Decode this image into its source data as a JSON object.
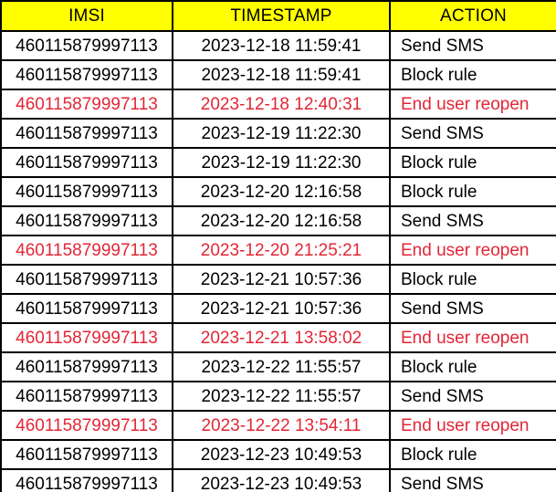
{
  "table": {
    "columns": [
      {
        "key": "imsi",
        "label": "IMSI"
      },
      {
        "key": "timestamp",
        "label": "TIMESTAMP"
      },
      {
        "key": "action",
        "label": "ACTION"
      }
    ],
    "header_background": "#FFFF00",
    "highlight_color": "#E32636",
    "text_color": "#000000",
    "border_color": "#000000",
    "rows": [
      {
        "imsi": "460115879997113",
        "timestamp": "2023-12-18 11:59:41",
        "action": "Send SMS",
        "highlighted": false
      },
      {
        "imsi": "460115879997113",
        "timestamp": "2023-12-18 11:59:41",
        "action": "Block rule",
        "highlighted": false
      },
      {
        "imsi": "460115879997113",
        "timestamp": "2023-12-18 12:40:31",
        "action": "End user reopen",
        "highlighted": true
      },
      {
        "imsi": "460115879997113",
        "timestamp": "2023-12-19 11:22:30",
        "action": "Send SMS",
        "highlighted": false
      },
      {
        "imsi": "460115879997113",
        "timestamp": "2023-12-19 11:22:30",
        "action": "Block rule",
        "highlighted": false
      },
      {
        "imsi": "460115879997113",
        "timestamp": "2023-12-20 12:16:58",
        "action": "Block rule",
        "highlighted": false
      },
      {
        "imsi": "460115879997113",
        "timestamp": "2023-12-20 12:16:58",
        "action": "Send SMS",
        "highlighted": false
      },
      {
        "imsi": "460115879997113",
        "timestamp": "2023-12-20 21:25:21",
        "action": "End user reopen",
        "highlighted": true
      },
      {
        "imsi": "460115879997113",
        "timestamp": "2023-12-21 10:57:36",
        "action": "Block rule",
        "highlighted": false
      },
      {
        "imsi": "460115879997113",
        "timestamp": "2023-12-21 10:57:36",
        "action": "Send SMS",
        "highlighted": false
      },
      {
        "imsi": "460115879997113",
        "timestamp": "2023-12-21 13:58:02",
        "action": "End user reopen",
        "highlighted": true
      },
      {
        "imsi": "460115879997113",
        "timestamp": "2023-12-22 11:55:57",
        "action": "Block rule",
        "highlighted": false
      },
      {
        "imsi": "460115879997113",
        "timestamp": "2023-12-22 11:55:57",
        "action": "Send SMS",
        "highlighted": false
      },
      {
        "imsi": "460115879997113",
        "timestamp": "2023-12-22 13:54:11",
        "action": "End user reopen",
        "highlighted": true
      },
      {
        "imsi": "460115879997113",
        "timestamp": "2023-12-23 10:49:53",
        "action": "Block rule",
        "highlighted": false
      },
      {
        "imsi": "460115879997113",
        "timestamp": "2023-12-23 10:49:53",
        "action": "Send SMS",
        "highlighted": false
      }
    ]
  }
}
